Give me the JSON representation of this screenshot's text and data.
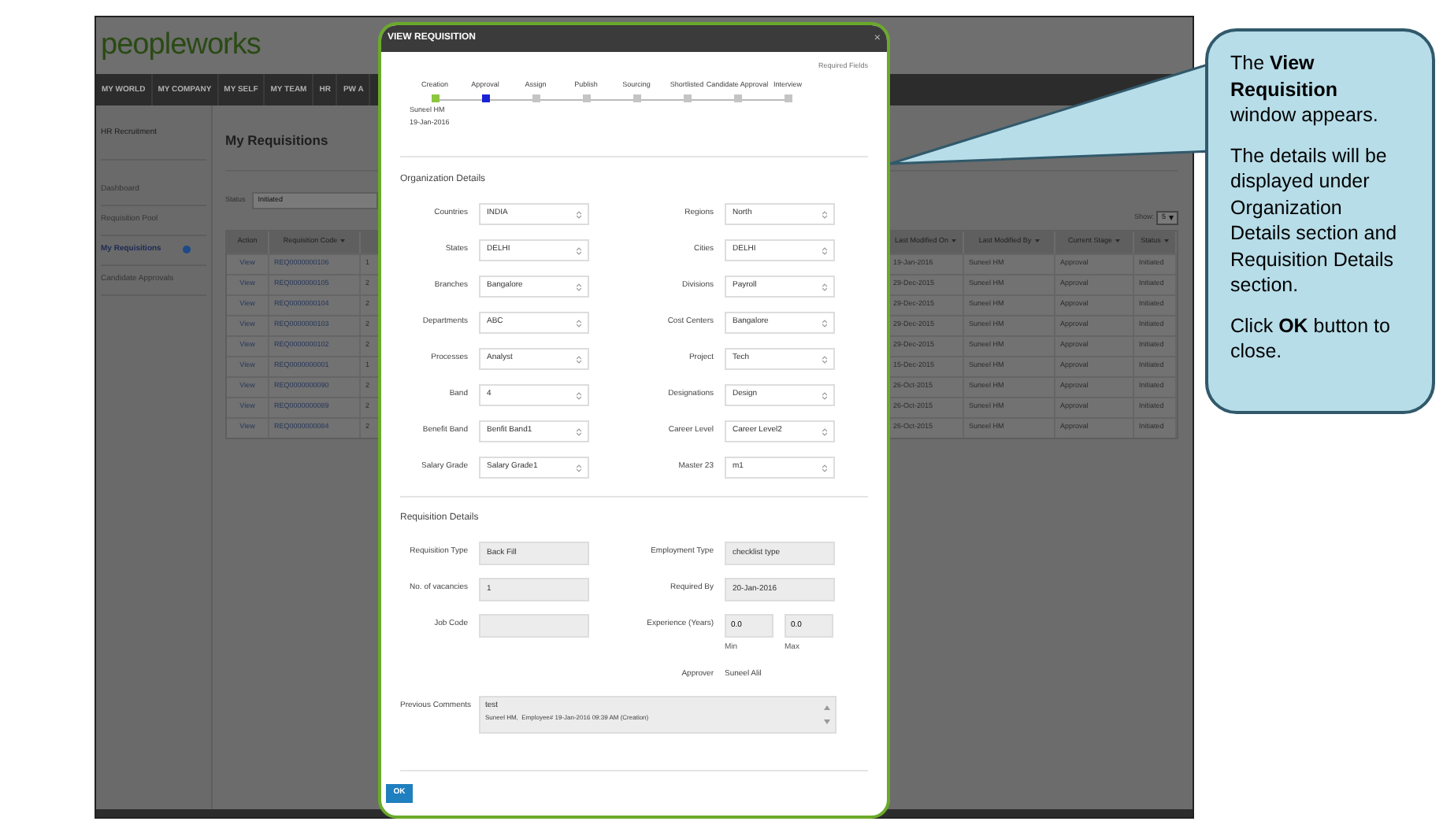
{
  "app": {
    "logo": "peopleworks",
    "nav": [
      {
        "label": "MY WORLD"
      },
      {
        "label": "MY COMPANY"
      },
      {
        "label": "MY SELF"
      },
      {
        "label": "MY TEAM"
      },
      {
        "label": "HR"
      },
      {
        "label": "PW A"
      }
    ],
    "sidebar": {
      "header": "HR Recruitment",
      "items": [
        {
          "label": "Dashboard",
          "selected": false
        },
        {
          "label": "Requisition Pool",
          "selected": false
        },
        {
          "label": "My Requisitions",
          "selected": true
        },
        {
          "label": "Candidate Approvals",
          "selected": false
        }
      ]
    },
    "page_title": "My Requisitions",
    "status_filter": {
      "label": "Status",
      "value": "Initiated"
    },
    "show": {
      "label": "Show:",
      "value": "5"
    },
    "table": {
      "columns": {
        "action": "Action",
        "code": "Requisition Code",
        "modified_on": "Last Modified On",
        "modified_by": "Last Modified By",
        "stage": "Current Stage",
        "status": "Status"
      },
      "rows": [
        {
          "action": "View",
          "code": "REQ0000000106",
          "column_3": "1",
          "modified_on": "19-Jan-2016",
          "modified_by": "Suneel HM",
          "stage": "Approval",
          "status": "Initiated"
        },
        {
          "action": "View",
          "code": "REQ0000000105",
          "column_3": "2",
          "modified_on": "29-Dec-2015",
          "modified_by": "Suneel HM",
          "stage": "Approval",
          "status": "Initiated"
        },
        {
          "action": "View",
          "code": "REQ0000000104",
          "column_3": "2",
          "modified_on": "29-Dec-2015",
          "modified_by": "Suneel HM",
          "stage": "Approval",
          "status": "Initiated"
        },
        {
          "action": "View",
          "code": "REQ0000000103",
          "column_3": "2",
          "modified_on": "29-Dec-2015",
          "modified_by": "Suneel HM",
          "stage": "Approval",
          "status": "Initiated"
        },
        {
          "action": "View",
          "code": "REQ0000000102",
          "column_3": "2",
          "modified_on": "29-Dec-2015",
          "modified_by": "Suneel HM",
          "stage": "Approval",
          "status": "Initiated"
        },
        {
          "action": "View",
          "code": "REQ0000000001",
          "column_3": "1",
          "modified_on": "15-Dec-2015",
          "modified_by": "Suneel HM",
          "stage": "Approval",
          "status": "Initiated"
        },
        {
          "action": "View",
          "code": "REQ0000000090",
          "column_3": "2",
          "modified_on": "26-Oct-2015",
          "modified_by": "Suneel HM",
          "stage": "Approval",
          "status": "Initiated"
        },
        {
          "action": "View",
          "code": "REQ0000000089",
          "column_3": "2",
          "modified_on": "26-Oct-2015",
          "modified_by": "Suneel HM",
          "stage": "Approval",
          "status": "Initiated"
        },
        {
          "action": "View",
          "code": "REQ0000000084",
          "column_3": "2",
          "modified_on": "26-Oct-2015",
          "modified_by": "Suneel HM",
          "stage": "Approval",
          "status": "Initiated"
        }
      ]
    }
  },
  "dialog": {
    "title": "VIEW REQUISITION",
    "close": "×",
    "required_note": "Required Fields",
    "stages": [
      {
        "label": "Creation",
        "completed": true,
        "current": false,
        "by": "Suneel HM",
        "date": "19-Jan-2016"
      },
      {
        "label": "Approval",
        "completed": false,
        "current": true
      },
      {
        "label": "Assign",
        "completed": false,
        "current": false
      },
      {
        "label": "Publish",
        "completed": false,
        "current": false
      },
      {
        "label": "Sourcing",
        "completed": false,
        "current": false
      },
      {
        "label": "Shortlisted",
        "completed": false,
        "current": false
      },
      {
        "label": "Candidate Approval",
        "completed": false,
        "current": false
      },
      {
        "label": "Interview",
        "completed": false,
        "current": false
      }
    ],
    "org_section": {
      "title": "Organization Details",
      "fields": [
        {
          "label": "Countries",
          "value": "INDIA"
        },
        {
          "label": "Regions",
          "value": "North"
        },
        {
          "label": "States",
          "value": "DELHI"
        },
        {
          "label": "Cities",
          "value": "DELHI"
        },
        {
          "label": "Branches",
          "value": "Bangalore"
        },
        {
          "label": "Divisions",
          "value": "Payroll"
        },
        {
          "label": "Departments",
          "value": "ABC"
        },
        {
          "label": "Cost Centers",
          "value": "Bangalore"
        },
        {
          "label": "Processes",
          "value": "Analyst"
        },
        {
          "label": "Project",
          "value": "Tech"
        },
        {
          "label": "Band",
          "value": "4"
        },
        {
          "label": "Designations",
          "value": "Design"
        },
        {
          "label": "Benefit Band",
          "value": "Benfit Band1"
        },
        {
          "label": "Career Level",
          "value": "Career Level2"
        },
        {
          "label": "Salary Grade",
          "value": "Salary Grade1"
        },
        {
          "label": "Master 23",
          "value": "m1"
        }
      ]
    },
    "req_section": {
      "title": "Requisition Details",
      "rows": [
        {
          "left": {
            "kind": "input",
            "label": "Requisition Type",
            "value": "Back Fill"
          },
          "right": {
            "kind": "input",
            "label": "Employment Type",
            "value": "checklist type"
          }
        },
        {
          "left": {
            "kind": "input",
            "label": "No. of vacancies",
            "value": "1"
          },
          "right": {
            "kind": "input",
            "label": "Required By",
            "value": "20-Jan-2016"
          }
        },
        {
          "left": {
            "kind": "input",
            "label": "Job Code"
          },
          "right": {
            "kind": "range",
            "label": "Experience (Years)",
            "min": "0.0",
            "min_label": "Min",
            "max": "0.0",
            "max_label": "Max"
          }
        },
        {
          "right": {
            "kind": "plain",
            "label": "Approver",
            "value": "Suneel Alil"
          }
        }
      ],
      "comments": {
        "label": "Previous Comments",
        "text": "test",
        "meta": "Suneel HM,  Employee# 19-Jan-2016 09:39 AM (Creation)"
      }
    },
    "ok_button": "OK"
  },
  "callout": {
    "paragraphs": [
      "The **View Requisition** window appears.",
      "The details will be displayed under Organization Details section and Requisition Details section.",
      "Click **OK** button to close."
    ]
  }
}
